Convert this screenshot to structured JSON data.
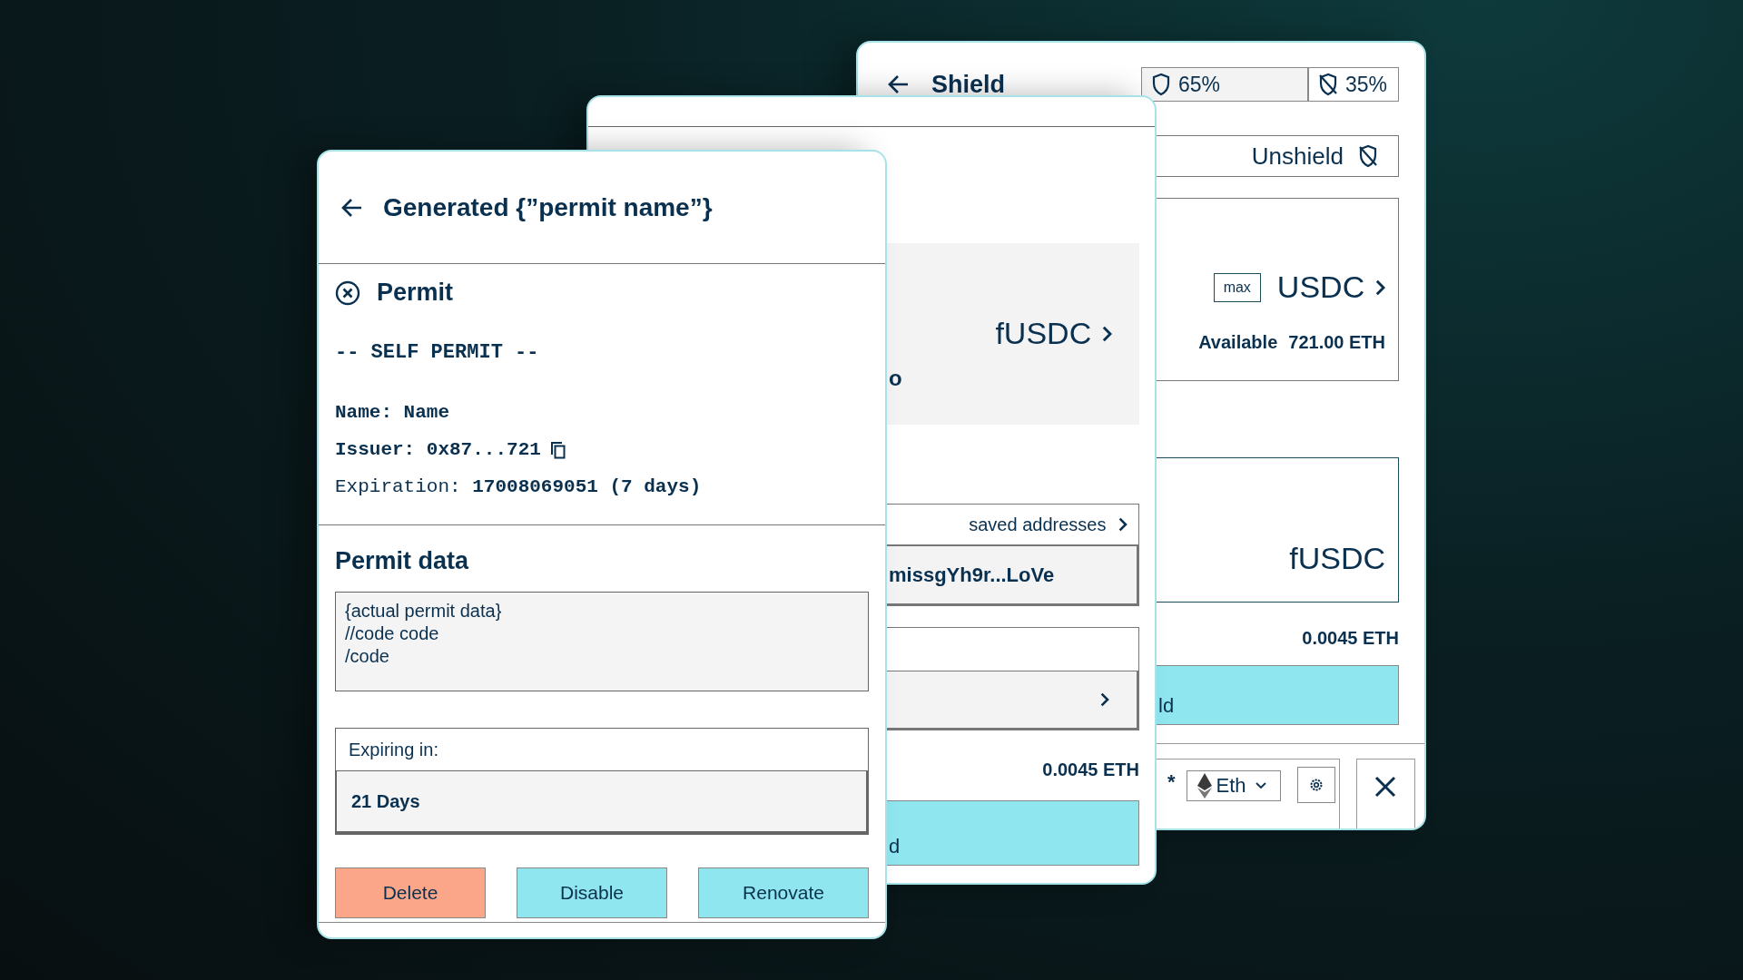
{
  "shield_card": {
    "title": "Shield",
    "shares": [
      {
        "label": "65%",
        "kind": "shielded"
      },
      {
        "label": "35%",
        "kind": "unshielded"
      }
    ],
    "mode_button": "Unshield",
    "max_button": "max",
    "token": "USDC",
    "available_label": "Available",
    "available_value": "721.00 ETH",
    "target_token": "fUSDC",
    "fee": "0.0045 ETH",
    "action_fragment": "ld",
    "asterisk": "*",
    "network": "Eth"
  },
  "send_card": {
    "token": "fUSDC",
    "amount_fragment": "o",
    "saved_addresses": "saved addresses",
    "address": "missgYh9r...LoVe",
    "fee": "0.0045 ETH",
    "action_fragment": "d"
  },
  "permit_card": {
    "title": "Generated {”permit name”}",
    "section_title": "Permit",
    "permit_type": "-- SELF PERMIT --",
    "details": [
      {
        "text": "Name: Name",
        "kind": "bold",
        "copyable": false
      },
      {
        "text": "Issuer: 0x87...721",
        "kind": "bold",
        "copyable": true
      },
      {
        "text": "Expiration: **17008069051 (7 days)**",
        "kind": "plain",
        "copyable": false
      }
    ],
    "data_title": "Permit data",
    "code_lines": [
      "{actual permit data}",
      "//code code",
      "/code"
    ],
    "expiring_label": "Expiring in:",
    "expiring_value": "21 Days",
    "buttons": [
      {
        "label": "Delete",
        "kind": "danger"
      },
      {
        "label": "Disable",
        "kind": "primary"
      },
      {
        "label": "Renovate",
        "kind": "primary"
      }
    ]
  }
}
